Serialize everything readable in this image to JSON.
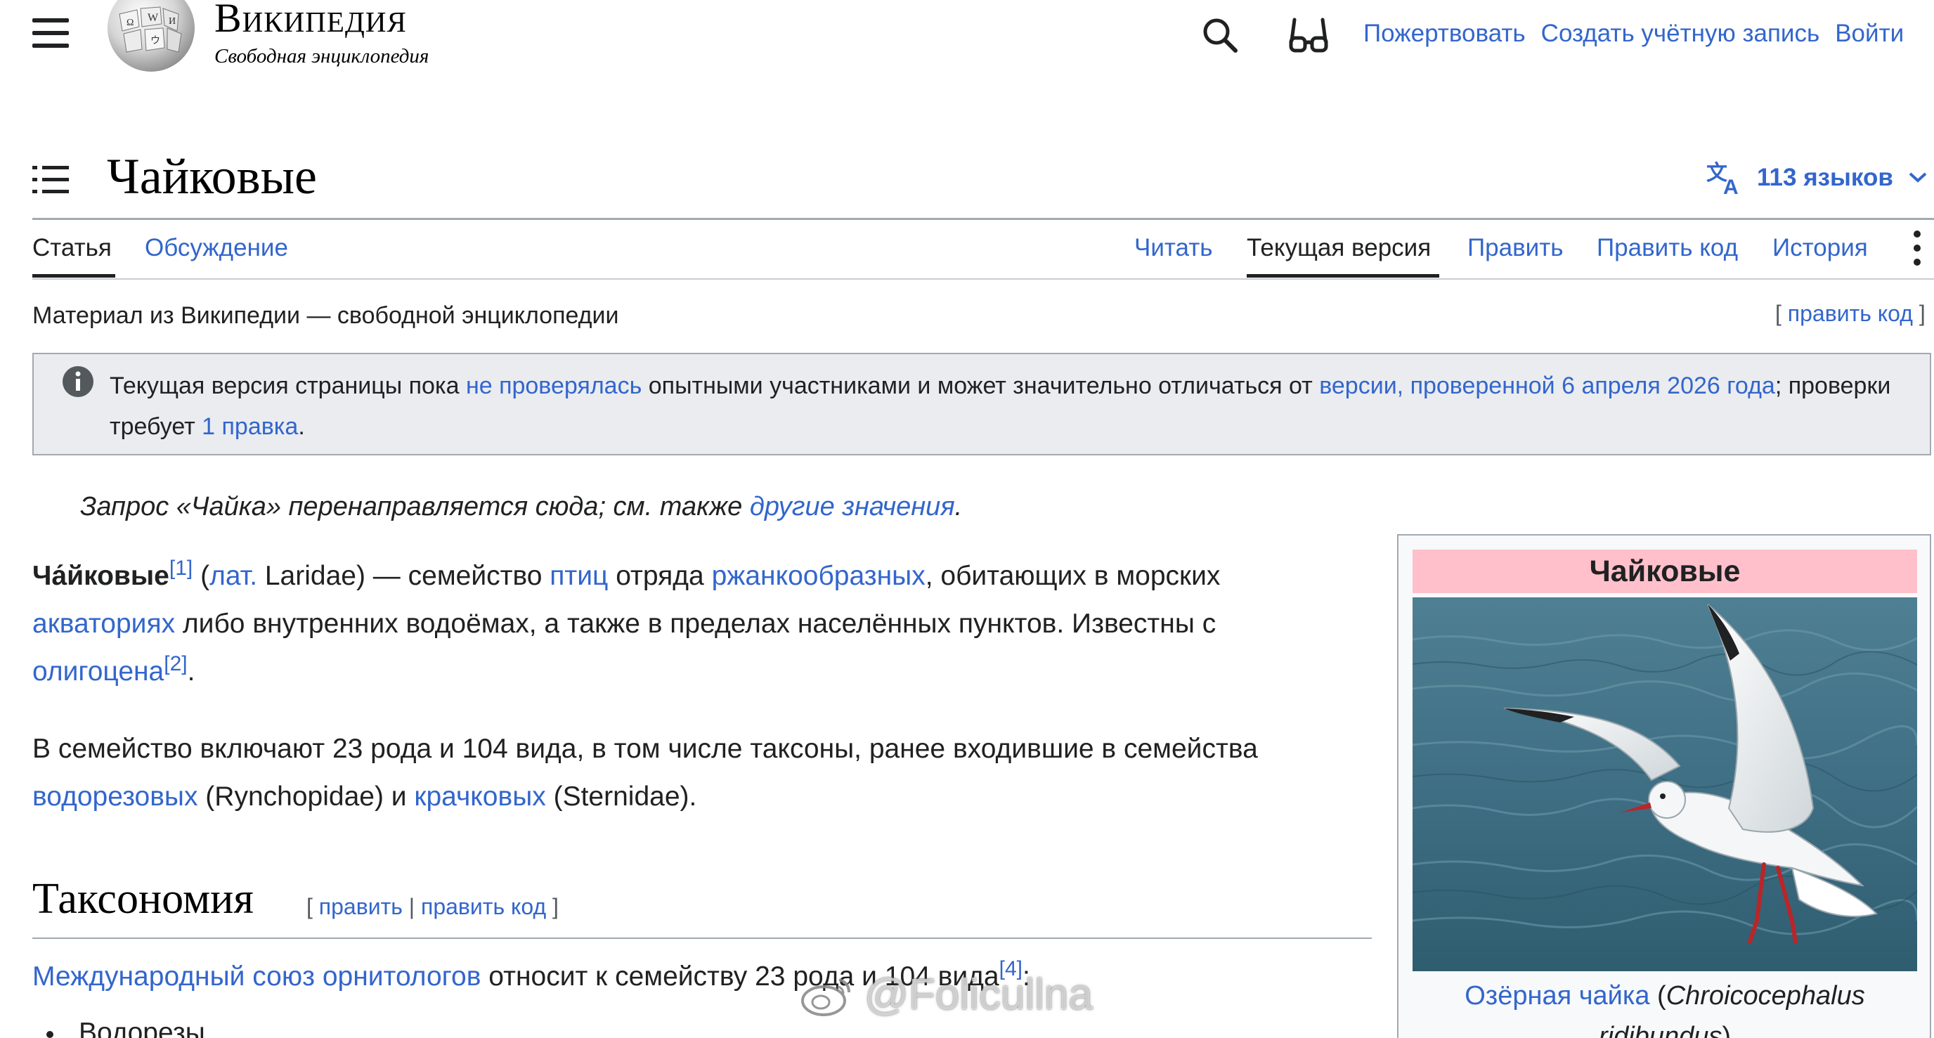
{
  "header": {
    "wordmark": "Википедия",
    "tagline": "Свободная энциклопедия",
    "links": {
      "donate": "Пожертвовать",
      "create_account": "Создать учётную запись",
      "login": "Войти"
    }
  },
  "title_bar": {
    "title": "Чайковые",
    "languages": "113 языков"
  },
  "tabs": {
    "article": "Статья",
    "talk": "Обсуждение",
    "read": "Читать",
    "current_version": "Текущая версия",
    "edit": "Править",
    "edit_source": "Править код",
    "history": "История"
  },
  "site_sub": "Материал из Википедии — свободной энциклопедии",
  "edit_code_top": {
    "open": "[",
    "label": "править код",
    "close": "]"
  },
  "notice": {
    "t1": "Текущая версия страницы пока ",
    "l1": "не проверялась",
    "t2": " опытными участниками и может значительно отличаться от ",
    "l2": "версии, проверенной 6 апреля 2026 года",
    "t3": "; проверки требует ",
    "l3": "1 правка",
    "t4": "."
  },
  "hatnote": {
    "text": "Запрос «Чайка» перенаправляется сюда; см. также ",
    "link": "другие значения",
    "end": "."
  },
  "para1": {
    "bold": "Ча́йковые",
    "ref1": "[1]",
    "t1": " (",
    "lat": "лат.",
    "t2": " Laridae) — семейство ",
    "birds": "птиц",
    "t3": " отряда ",
    "order": "ржанкообразных",
    "t4": ", обитающих в морских ",
    "waters": "акваториях",
    "t5": " либо внутренних водоёмах, а также в пределах населённых пунктов. Известны с ",
    "oligocene": "олигоцена",
    "ref2": "[2]",
    "t6": "."
  },
  "para2": {
    "t1": "В семейство включают 23 рода и 104 вида, в том числе таксоны, ранее входившие в семейства ",
    "l1": "водорезовых",
    "t2": " (Rynchopidae) и ",
    "l2": "крачковых",
    "t3": " (Sternidae)."
  },
  "section": {
    "heading": "Таксономия",
    "open": "[",
    "edit": "править",
    "pipe": "|",
    "edit_code": "править код",
    "close": "]"
  },
  "para3": {
    "link": "Международный союз орнитологов",
    "text": " относит к семейству 23 рода и 104 вида",
    "ref": "[4]",
    "end": ":"
  },
  "list": {
    "item1": "Водорезы"
  },
  "infobox": {
    "title": "Чайковые",
    "caption_link": "Озёрная чайка",
    "caption_open": " (",
    "caption_latin": "Chroicocephalus ridibundus",
    "caption_close": ")"
  },
  "watermark": "@Folicullna",
  "colors": {
    "link": "#3366cc",
    "infobox_header": "#ffc0cb",
    "notice_bg": "#eaecf0"
  }
}
